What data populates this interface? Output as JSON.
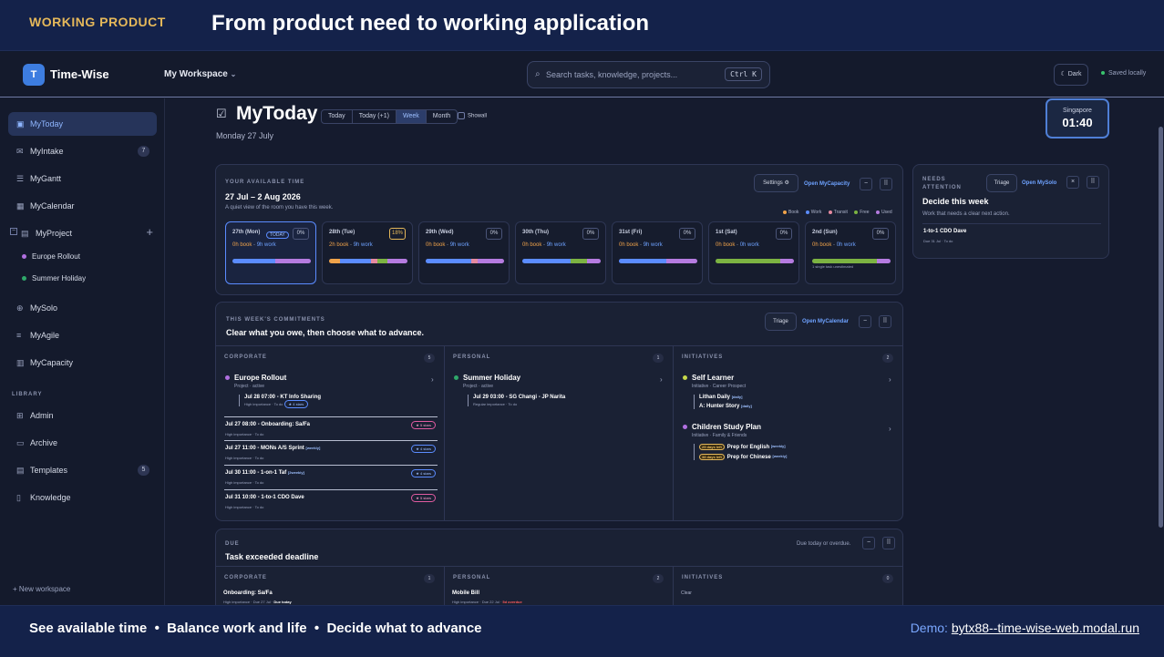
{
  "banner": {
    "tag": "WORKING PRODUCT",
    "headline": "From product need to working application",
    "tagline": "See available time  •  Balance work and life  •  Decide what to advance",
    "demo_label": "Demo: ",
    "demo_link": "bytx88--time-wise-web.modal.run"
  },
  "topbar": {
    "logo_letter": "T",
    "brand": "Time-Wise",
    "workspace": "My Workspace",
    "search_placeholder": "Search tasks, knowledge, projects...",
    "search_shortcut": "Ctrl K",
    "theme_button": "Dark",
    "saved_status": "Saved locally"
  },
  "sidebar": {
    "items": [
      {
        "label": "MyToday",
        "icon": "calendar-check-icon",
        "glyph": "▣"
      },
      {
        "label": "MyIntake",
        "icon": "inbox-icon",
        "glyph": "✉",
        "badge": "7"
      },
      {
        "label": "MyGantt",
        "icon": "gantt-icon",
        "glyph": "☰"
      },
      {
        "label": "MyCalendar",
        "icon": "calendar-icon",
        "glyph": "▦"
      },
      {
        "label": "MyProject",
        "icon": "project-icon",
        "glyph": "▤"
      },
      {
        "label": "MySolo",
        "icon": "target-icon",
        "glyph": "⊕"
      },
      {
        "label": "MyAgile",
        "icon": "list-icon",
        "glyph": "≡"
      },
      {
        "label": "MyCapacity",
        "icon": "chart-icon",
        "glyph": "▥"
      }
    ],
    "projects": [
      {
        "label": "Europe Rollout",
        "color": "#b06fe0"
      },
      {
        "label": "Summer Holiday",
        "color": "#2fa86a"
      }
    ],
    "library_heading": "LIBRARY",
    "library": [
      {
        "label": "Admin",
        "icon": "grid-icon",
        "glyph": "⊞"
      },
      {
        "label": "Archive",
        "icon": "archive-icon",
        "glyph": "▭"
      },
      {
        "label": "Templates",
        "icon": "template-icon",
        "glyph": "▤",
        "badge": "5"
      },
      {
        "label": "Knowledge",
        "icon": "book-icon",
        "glyph": "▯"
      }
    ],
    "new_workspace": "+ New workspace"
  },
  "page": {
    "title": "MyToday",
    "date": "Monday 27 July",
    "views": [
      "Today",
      "Today (+1)",
      "Week",
      "Month"
    ],
    "active_view": "Week",
    "show_all": "Showall",
    "clock_city": "Singapore",
    "clock_time": "01:40"
  },
  "available": {
    "eyebrow": "YOUR AVAILABLE TIME",
    "title": "27 Jul – 2 Aug 2026",
    "subtitle": "A quiet view of the room you have this week.",
    "settings": "Settings ⚙",
    "open_link": "Open MyCapacity",
    "legend": [
      {
        "label": "Book",
        "color": "#f0a34a"
      },
      {
        "label": "Work",
        "color": "#5b8cff"
      },
      {
        "label": "Transit",
        "color": "#e58aa0"
      },
      {
        "label": "Free",
        "color": "#7cb342"
      },
      {
        "label": "Used",
        "color": "#b57be0"
      }
    ],
    "days": [
      {
        "name": "27th (Mon)",
        "pct": "0%",
        "book": "0h book",
        "work": "9h work",
        "today": "TODAY"
      },
      {
        "name": "28th (Tue)",
        "pct": "18%",
        "book": "2h book",
        "work": "9h work"
      },
      {
        "name": "29th (Wed)",
        "pct": "0%",
        "book": "0h book",
        "work": "9h work"
      },
      {
        "name": "30th (Thu)",
        "pct": "0%",
        "book": "0h book",
        "work": "9h work"
      },
      {
        "name": "31st (Fri)",
        "pct": "0%",
        "book": "0h book",
        "work": "9h work"
      },
      {
        "name": "1st (Sat)",
        "pct": "0%",
        "book": "0h book",
        "work": "0h work"
      },
      {
        "name": "2nd (Sun)",
        "pct": "0%",
        "book": "0h book",
        "work": "0h work",
        "note": "1 single task unestimated"
      }
    ]
  },
  "attention": {
    "eyebrow": "NEEDS ATTENTION",
    "triage": "Triage",
    "open_link": "Open MySolo",
    "title": "Decide this week",
    "subtitle": "Work that needs a clear next action.",
    "item_title": "1-to-1 CDO Dave",
    "item_meta": "Due 31 Jul · To do"
  },
  "commitments": {
    "eyebrow": "THIS WEEK'S COMMITMENTS",
    "title": "Clear what you owe, then choose what to advance.",
    "triage": "Triage",
    "open_link": "Open MyCalendar",
    "corporate": {
      "heading": "CORPORATE",
      "count": "5",
      "project": "Europe Rollout",
      "project_meta": "Project · active",
      "sub_title": "Jul 28 07:00 - KT Info Sharing",
      "sub_meta": "High importance · To do",
      "sub_pill": "★ 4 stars",
      "tasks": [
        {
          "title": "Jul 27 08:00 - Onboarding: Sa/Fa",
          "meta": "High importance · To do",
          "pill": "★ 5 stars",
          "rec": ""
        },
        {
          "title": "Jul 27 11:00 - MONs A/S Sprint",
          "meta": "High importance · To do",
          "pill": "★ 4 stars",
          "rec": "[weekly]"
        },
        {
          "title": "Jul 30 11:00 - 1-on-1 Taf",
          "meta": "High importance · To do",
          "pill": "★ 4 stars",
          "rec": "[2weekly]"
        },
        {
          "title": "Jul 31 10:00 - 1-to-1 CDO Dave",
          "meta": "High importance · To do",
          "pill": "★ 5 stars",
          "rec": ""
        }
      ]
    },
    "personal": {
      "heading": "PERSONAL",
      "count": "1",
      "project": "Summer Holiday",
      "project_meta": "Project · active",
      "sub_title": "Jul 29 03:00 - SG Changi - JP Narita",
      "sub_meta": "Regular importance · To do"
    },
    "initiatives": {
      "heading": "INITIATIVES",
      "count": "2",
      "items": [
        {
          "title": "Self Learner",
          "meta": "Initiative · Career Prospect",
          "color": "#c6d84a",
          "subs": [
            {
              "label": "Lithan Daily",
              "rec": "[daily]"
            },
            {
              "label": "A: Hunter Story",
              "rec": "[daily]"
            }
          ]
        },
        {
          "title": "Children Study Plan",
          "meta": "Initiative · Family & Friends",
          "color": "#b06fe0",
          "subs": [
            {
              "label": "Prep for English",
              "rec": "[weekly]",
              "due": "25 days left"
            },
            {
              "label": "Prep for Chinese",
              "rec": "[weekly]",
              "due": "38 days left"
            }
          ]
        }
      ]
    }
  },
  "due": {
    "eyebrow": "DUE",
    "title": "Task exceeded deadline",
    "hint": "Due today or overdue.",
    "corporate": {
      "heading": "CORPORATE",
      "count": "1",
      "item": "Onboarding: Sa/Fa",
      "meta_a": "High importance",
      "meta_b": "Due 27 Jul",
      "status": "Due today"
    },
    "personal": {
      "heading": "PERSONAL",
      "count": "2",
      "item": "Mobile Bill",
      "meta_a": "High importance",
      "meta_b": "Due 22 Jul",
      "status": "5d overdue"
    },
    "initiatives": {
      "heading": "INITIATIVES",
      "count": "0",
      "item": "Clear"
    }
  }
}
